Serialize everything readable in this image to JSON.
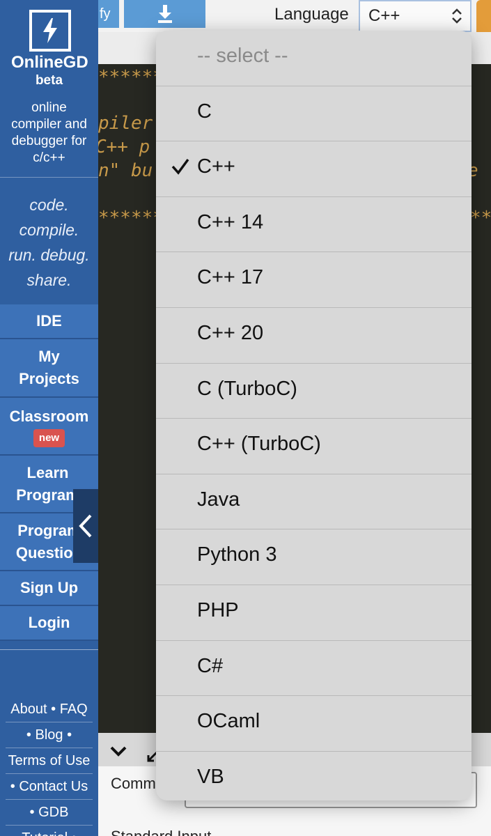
{
  "sidebar": {
    "brand": "OnlineGD",
    "beta": "beta",
    "description": "online\ncompiler and\ndebugger for\nc/c++",
    "tagline": [
      "code.",
      "compile.",
      "run. debug.",
      "share."
    ],
    "nav": [
      {
        "label": "IDE"
      },
      {
        "label": "My\nProjects"
      },
      {
        "label": "Classroom",
        "badge": "new"
      },
      {
        "label": "Learn\nProgram"
      },
      {
        "label": "Program\nQuestion"
      },
      {
        "label": "Sign Up"
      },
      {
        "label": "Login"
      }
    ],
    "footer_links": [
      "About",
      "FAQ",
      "Blog",
      "Terms of Use",
      "Contact Us",
      "GDB",
      "Tutorial"
    ]
  },
  "toolbar": {
    "beautify_label": "fy",
    "download_icon": "download-icon",
    "language_label": "Language",
    "language_value": "C++"
  },
  "editor": {
    "lines": [
      "*********",
      "piler",
      "C++ p",
      "n\" bu",
      "*********"
    ],
    "right_fragments": [
      "e",
      "**"
    ]
  },
  "console": {
    "command_label": "Comm",
    "stdin_label": "Standard Input"
  },
  "dropdown": {
    "options": [
      {
        "label": "-- select --",
        "placeholder": true
      },
      {
        "label": "C"
      },
      {
        "label": "C++",
        "selected": true
      },
      {
        "label": "C++ 14"
      },
      {
        "label": "C++ 17"
      },
      {
        "label": "C++ 20"
      },
      {
        "label": "C (TurboC)"
      },
      {
        "label": "C++ (TurboC)"
      },
      {
        "label": "Java"
      },
      {
        "label": "Python 3"
      },
      {
        "label": "PHP"
      },
      {
        "label": "C#"
      },
      {
        "label": "OCaml"
      },
      {
        "label": "VB"
      }
    ]
  },
  "colors": {
    "sidebar": "#2f5fa0",
    "nav_button": "#3d72b8",
    "badge": "#d9534f",
    "editor_bg": "#272822",
    "editor_text": "#c89a4a",
    "accent_button": "#5b9bd5",
    "run_button": "#e39c3a"
  }
}
